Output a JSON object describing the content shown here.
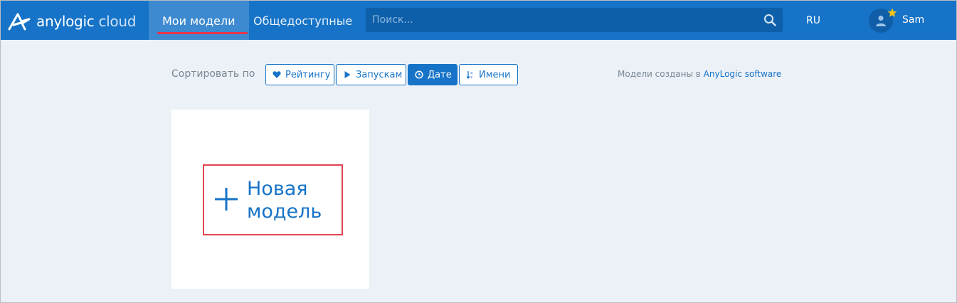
{
  "header": {
    "logo_text_main": "anylogic",
    "logo_text_sub": "cloud",
    "tabs": [
      {
        "label": "Мои модели",
        "active": true
      },
      {
        "label": "Общедоступные",
        "active": false
      }
    ],
    "search_placeholder": "Поиск...",
    "language": "RU",
    "username": "Sam"
  },
  "sort": {
    "label": "Сортировать по",
    "buttons": [
      {
        "label": "Рейтингу",
        "icon": "heart-icon",
        "active": false
      },
      {
        "label": "Запускам",
        "icon": "play-icon",
        "active": false
      },
      {
        "label": "Дате",
        "icon": "clock-icon",
        "active": true
      },
      {
        "label": "Имени",
        "icon": "sort-alpha-icon",
        "active": false
      }
    ]
  },
  "credit": {
    "prefix": "Модели созданы в",
    "link": "AnyLogic software"
  },
  "new_model": {
    "line1": "Новая",
    "line2": "модель"
  },
  "colors": {
    "header_bg": "#1673c7",
    "page_bg": "#ecf1f7",
    "accent": "#1673c7",
    "highlight_border": "#e04552",
    "tab_underline": "#e8344a",
    "star": "#f5c518"
  }
}
